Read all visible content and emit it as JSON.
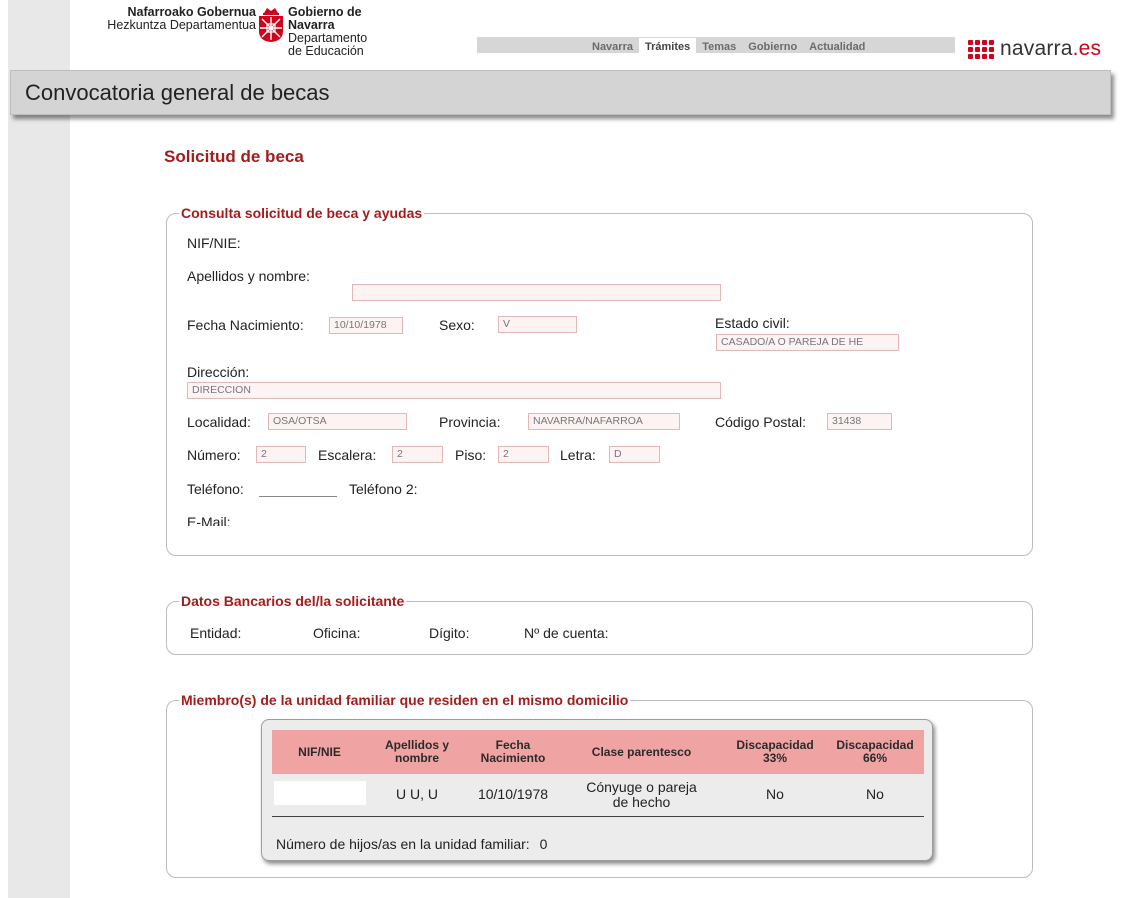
{
  "header": {
    "gov_left_line1": "Nafarroako Gobernua",
    "gov_left_line2": "Hezkuntza Departamentua",
    "gov_right_line1": "Gobierno de Navarra",
    "gov_right_line2": "Departamento de Educación",
    "nav": [
      "Navarra",
      "Trámites",
      "Temas",
      "Gobierno",
      "Actualidad"
    ],
    "nav_active": "Trámites",
    "brand_main": "navarra",
    "brand_ext": ".es",
    "brand_color": "#d0021b"
  },
  "page_title": "Convocatoria general de becas",
  "section_title": "Solicitud de beca",
  "consulta": {
    "legend": "Consulta solicitud de beca y ayudas",
    "nif_label": "NIF/NIE:",
    "apellidos_label": "Apellidos y nombre:",
    "apellidos_value": "",
    "fecha_label": "Fecha Nacimiento:",
    "fecha_value": "10/10/1978",
    "sexo_label": "Sexo:",
    "sexo_value": "V",
    "estado_label": "Estado civil:",
    "estado_value": "CASADO/A O PAREJA DE HE",
    "direccion_label": "Dirección:",
    "direccion_value": "DIRECCION",
    "localidad_label": "Localidad:",
    "localidad_value": "OSA/OTSA",
    "provincia_label": "Provincia:",
    "provincia_value": "NAVARRA/NAFARROA",
    "cp_label": "Código Postal:",
    "cp_value": "31438",
    "numero_label": "Número:",
    "numero_value": "2",
    "escalera_label": "Escalera:",
    "escalera_value": "2",
    "piso_label": "Piso:",
    "piso_value": "2",
    "letra_label": "Letra:",
    "letra_value": "D",
    "telefono_label": "Teléfono:",
    "telefono2_label": "Teléfono 2:",
    "email_label": "E-Mail:"
  },
  "bancarios": {
    "legend": "Datos Bancarios del/la solicitante",
    "entidad_label": "Entidad:",
    "oficina_label": "Oficina:",
    "digito_label": "Dígito:",
    "cuenta_label": "Nº de cuenta:"
  },
  "familia": {
    "legend": "Miembro(s) de la unidad familiar que residen en el mismo domicilio",
    "headers": [
      "NIF/NIE",
      "Apellidos y nombre",
      "Fecha Nacimiento",
      "Clase parentesco",
      "Discapacidad 33%",
      "Discapacidad 66%"
    ],
    "row": {
      "nif": "",
      "nombre": "U U, U",
      "fecha": "10/10/1978",
      "parentesco": "Cónyuge o pareja de hecho",
      "disc33": "No",
      "disc66": "No"
    },
    "hijos_label": "Número de hijos/as en la unidad familiar:",
    "hijos_value": "0"
  }
}
